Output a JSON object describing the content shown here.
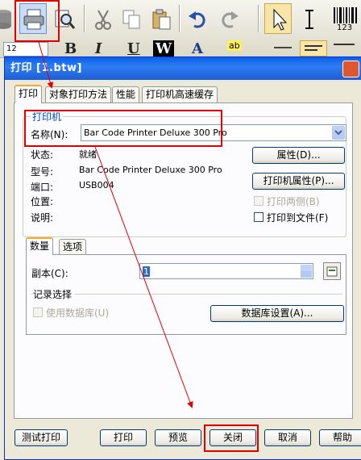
{
  "toolbar": {
    "font_size": "12",
    "format_glyphs": [
      "B",
      "I",
      "U",
      "W",
      "A"
    ],
    "barcode_label": "123",
    "marker_label": "ab"
  },
  "dialog": {
    "title": "打印 [1.btw]",
    "tabs": [
      {
        "label": "打印"
      },
      {
        "label": "对象打印方法"
      },
      {
        "label": "性能"
      },
      {
        "label": "打印机高速缓存"
      }
    ],
    "printer_group": {
      "legend": "打印机",
      "name_label": "名称(N):",
      "name_value": "Bar Code Printer Deluxe 300 Pro",
      "status_label": "状态:",
      "status_value": "就绪",
      "model_label": "型号:",
      "model_value": "Bar Code Printer Deluxe 300 Pro",
      "port_label": "端口:",
      "port_value": "USB004",
      "location_label": "位置:",
      "comment_label": "说明:",
      "properties_button": "属性(D)...",
      "printer_properties_button": "打印机属性(P)...",
      "duplex_label": "打印两侧(B)",
      "print_to_file_label": "打印到文件(F)"
    },
    "inner_tabs": [
      {
        "label": "数量"
      },
      {
        "label": "选项"
      }
    ],
    "quantity": {
      "copies_label": "副本(C):",
      "copies_value": "1"
    },
    "record_selection": {
      "legend": "记录选择",
      "use_database_label": "使用数据库(U)",
      "database_settings_button": "数据库设置(A)..."
    },
    "footer": {
      "test_print": "测试打印",
      "print": "打印",
      "preview": "预览",
      "close": "关闭",
      "cancel": "取消",
      "help": "帮助"
    }
  },
  "colors": {
    "highlight_red": "#e00000",
    "titlebar_blue": "#0a5fe8"
  }
}
